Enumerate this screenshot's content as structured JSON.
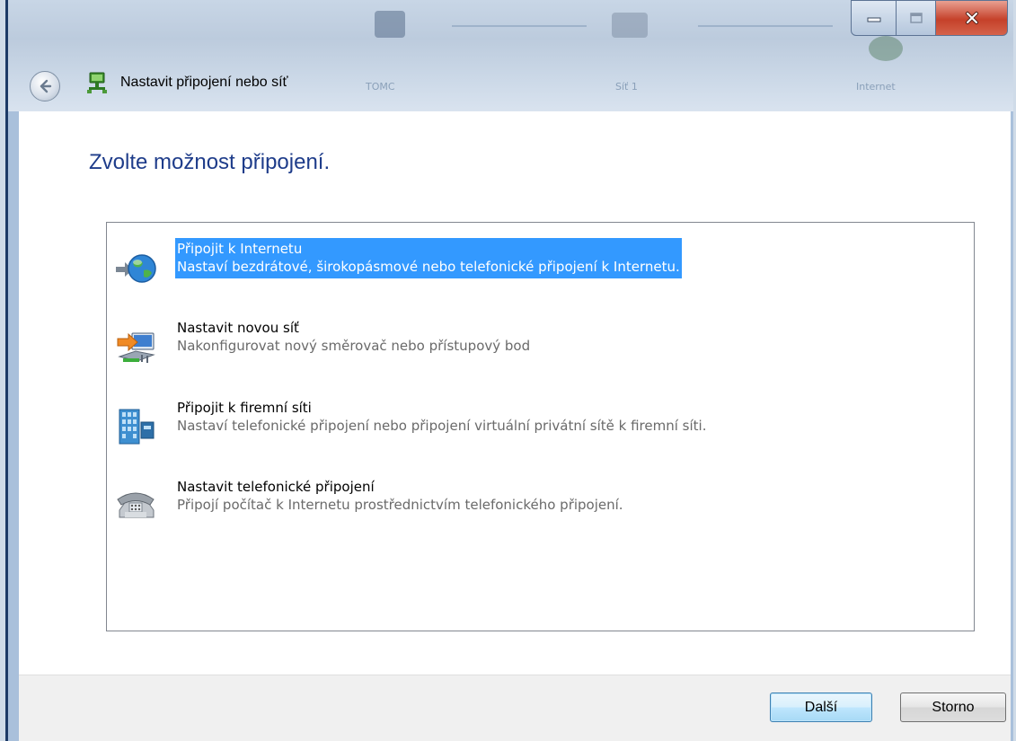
{
  "window": {
    "title": "Nastavit připojení nebo síť",
    "background_labels": [
      "TOMC",
      "Síť 1",
      "Internet"
    ]
  },
  "main": {
    "heading": "Zvolte možnost připojení."
  },
  "options": [
    {
      "title": "Připojit k Internetu",
      "description": "Nastaví bezdrátové, širokopásmové nebo telefonické připojení k Internetu.",
      "icon": "globe-icon",
      "selected": true
    },
    {
      "title": "Nastavit novou síť",
      "description": "Nakonfigurovat nový směrovač nebo přístupový bod",
      "icon": "router-icon",
      "selected": false
    },
    {
      "title": "Připojit k firemní síti",
      "description": "Nastaví telefonické připojení nebo připojení virtuální privátní sítě k firemní síti.",
      "icon": "office-building-icon",
      "selected": false
    },
    {
      "title": "Nastavit telefonické připojení",
      "description": "Připojí počítač k Internetu prostřednictvím telefonického připojení.",
      "icon": "telephone-icon",
      "selected": false
    }
  ],
  "footer": {
    "next_label": "Další",
    "cancel_label": "Storno"
  },
  "colors": {
    "heading": "#1e3c8a",
    "selection": "#3399ff"
  }
}
